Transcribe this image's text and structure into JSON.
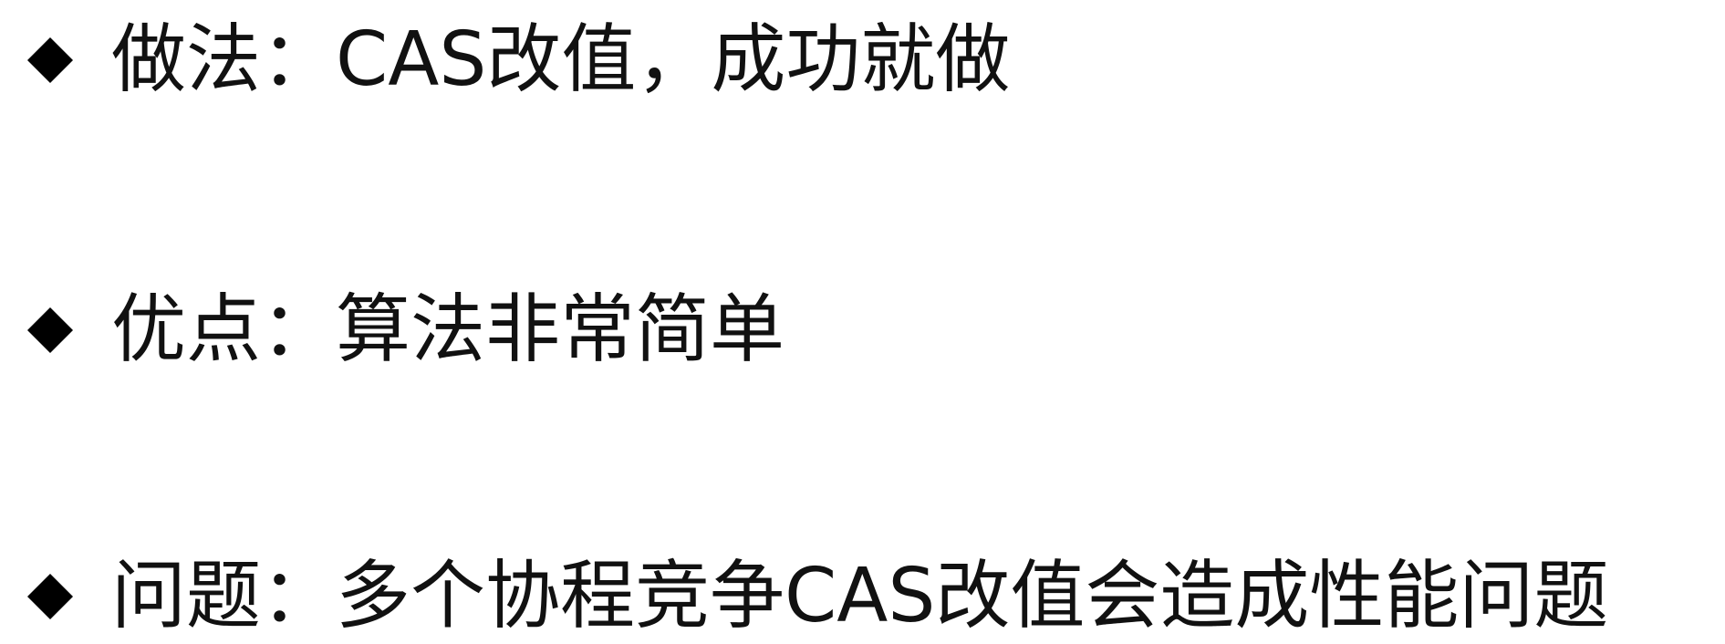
{
  "slide": {
    "bullets": [
      {
        "icon": "diamond-icon",
        "term": "做法：",
        "description": "CAS改值，成功就做"
      },
      {
        "icon": "diamond-icon",
        "term": "优点：",
        "description": "算法非常简单"
      },
      {
        "icon": "diamond-icon",
        "term": "问题：",
        "description": "多个协程竞争CAS改值会造成性能问题"
      }
    ]
  },
  "colors": {
    "text": "#111111",
    "background": "#ffffff",
    "bullet": "#000000"
  }
}
